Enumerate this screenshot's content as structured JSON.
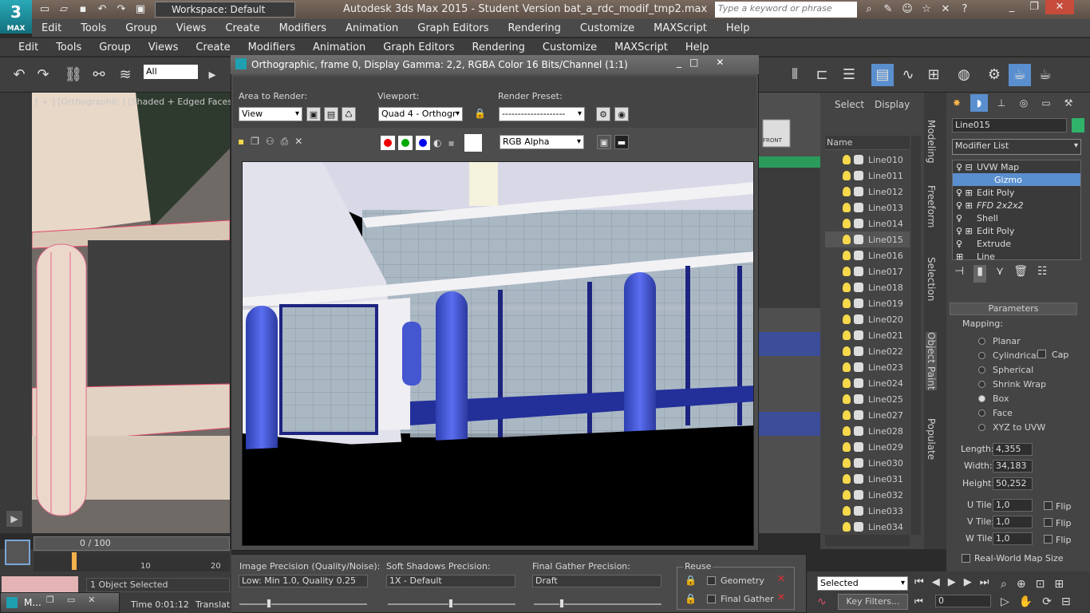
{
  "app": {
    "logo_text": "MAX",
    "workspace": "Workspace: Default",
    "window_title": "Autodesk 3ds Max  2015  - Student Version    bat_a_rdc_modif_tmp2.max",
    "search_placeholder": "Type a keyword or phrase"
  },
  "menu_primary": [
    "Edit",
    "Tools",
    "Group",
    "Views",
    "Create",
    "Modifiers",
    "Animation",
    "Graph Editors",
    "Rendering",
    "Customize",
    "MAXScript",
    "Help"
  ],
  "menu_secondary": [
    "Edit",
    "Tools",
    "Group",
    "Views",
    "Create",
    "Modifiers",
    "Animation",
    "Graph Editors",
    "Rendering",
    "Customize",
    "MAXScript",
    "Help"
  ],
  "toolbar": {
    "selection_filter": "All"
  },
  "viewport": {
    "label": "[ + ] [Orthographic ] [Shaded + Edged Faces ]"
  },
  "render_window": {
    "title": "Orthographic, frame 0, Display Gamma: 2,2, RGBA Color 16 Bits/Channel (1:1)",
    "area_label": "Area to Render:",
    "area_value": "View",
    "viewport_label": "Viewport:",
    "viewport_value": "Quad 4 - Orthogr",
    "preset_label": "Render Preset:",
    "preset_value": "--------------------",
    "channel_value": "RGB Alpha"
  },
  "render_settings": {
    "image_precision_label": "Image Precision (Quality/Noise):",
    "image_precision_value": "Low: Min 1.0, Quality 0.25",
    "soft_shadows_label": "Soft Shadows Precision:",
    "soft_shadows_value": "1X - Default",
    "final_gather_label": "Final Gather Precision:",
    "final_gather_value": "Draft",
    "reuse_label": "Reuse",
    "reuse_geometry": "Geometry",
    "reuse_final_gather": "Final Gather"
  },
  "scene_explorer": {
    "tab_select": "Select",
    "tab_display": "Display",
    "column_name": "Name",
    "items": [
      "Line010",
      "Line011",
      "Line012",
      "Line013",
      "Line014",
      "Line015",
      "Line016",
      "Line017",
      "Line018",
      "Line019",
      "Line020",
      "Line021",
      "Line022",
      "Line023",
      "Line024",
      "Line025",
      "Line027",
      "Line028",
      "Line029",
      "Line030",
      "Line031",
      "Line032",
      "Line033",
      "Line034"
    ],
    "selected": "Line015"
  },
  "side_tabs": [
    "Modeling",
    "Freeform",
    "Selection",
    "Object Paint",
    "Populate"
  ],
  "modifier_panel": {
    "object_name": "Line015",
    "modifier_list_label": "Modifier List",
    "stack": [
      "UVW Map",
      "Gizmo",
      "Edit Poly",
      "FFD 2x2x2",
      "Shell",
      "Edit Poly",
      "Extrude",
      "Line"
    ],
    "parameters_title": "Parameters",
    "mapping_label": "Mapping:",
    "mapping_options": [
      "Planar",
      "Cylindrical",
      "Spherical",
      "Shrink Wrap",
      "Box",
      "Face",
      "XYZ to UVW"
    ],
    "mapping_selected": "Box",
    "cap_label": "Cap",
    "length_label": "Length:",
    "length_value": "4,355",
    "width_label": "Width:",
    "width_value": "34,183",
    "height_label": "Height:",
    "height_value": "50,252",
    "u_tile_label": "U Tile:",
    "u_tile_value": "1,0",
    "v_tile_label": "V Tile:",
    "v_tile_value": "1,0",
    "w_tile_label": "W Tile:",
    "w_tile_value": "1,0",
    "flip_label": "Flip",
    "real_world_label": "Real-World Map Size"
  },
  "status": {
    "frame_counter": "0 / 100",
    "tick_10": "10",
    "tick_20": "20",
    "selection_status": "1 Object Selected",
    "time_label": "Time  0:01:12",
    "translation_label": "Translat",
    "taskbar_label": "M...",
    "selected_set": "Selected",
    "key_filters": "Key Filters...",
    "frame_value": "0"
  },
  "viewcube_label": "FRONT"
}
